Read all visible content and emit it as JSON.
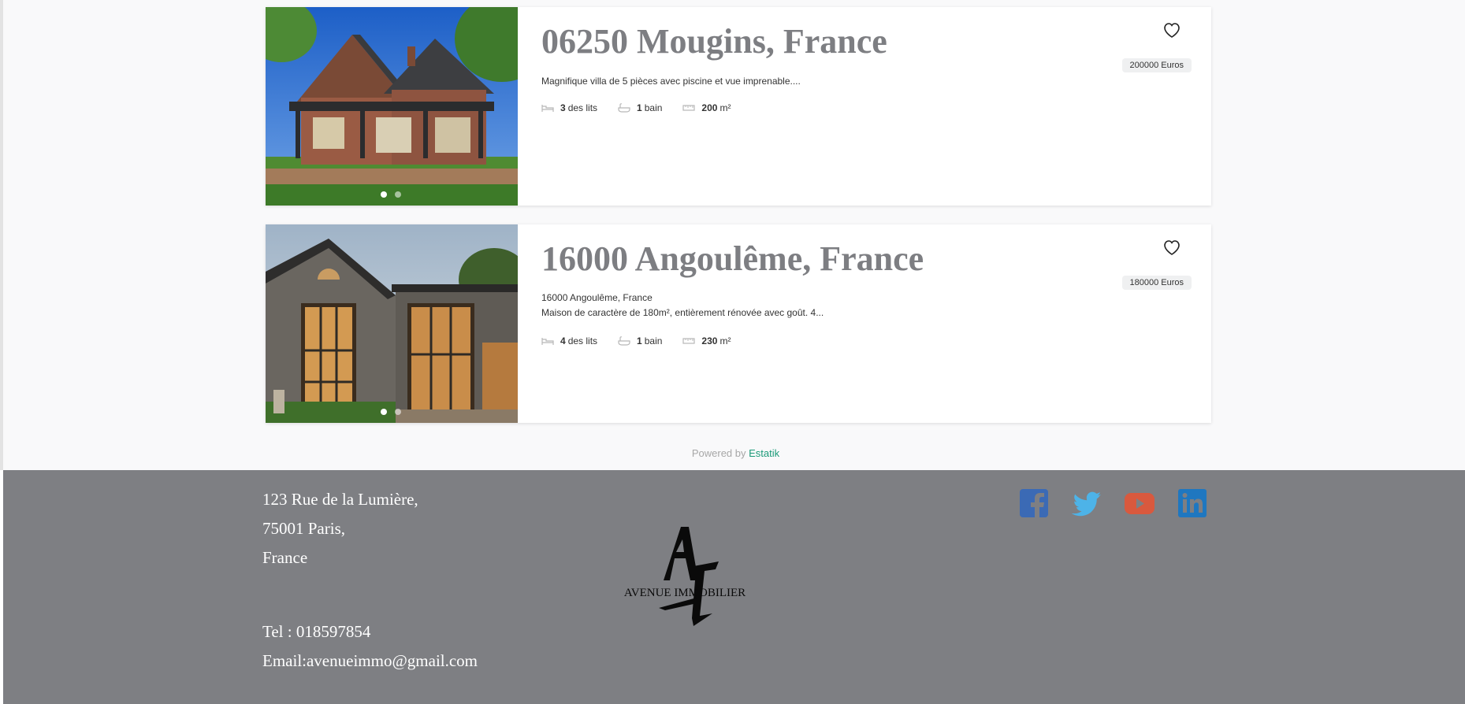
{
  "listings": [
    {
      "title": "06250 Mougins, France",
      "description_lines": [
        "Magnifique villa de 5 pièces avec piscine et vue imprenable...."
      ],
      "beds_value": "3",
      "beds_unit": "des lits",
      "baths_value": "1",
      "baths_unit": "bain",
      "area_value": "200",
      "area_unit": "m²",
      "price": "200000 Euros",
      "image_dots": 2,
      "active_dot": 0
    },
    {
      "title": "16000 Angoulême, France",
      "description_lines": [
        "16000 Angoulême, France",
        "Maison de caractère de 180m², entièrement rénovée avec goût. 4..."
      ],
      "beds_value": "4",
      "beds_unit": "des lits",
      "baths_value": "1",
      "baths_unit": "bain",
      "area_value": "230",
      "area_unit": "m²",
      "price": "180000 Euros",
      "image_dots": 2,
      "active_dot": 0
    }
  ],
  "powered": {
    "prefix": "Powered by",
    "link": "Estatik"
  },
  "footer": {
    "address_line1": "123 Rue de la Lumière,",
    "address_line2": "75001 Paris,",
    "address_line3": "France",
    "phone": "Tel : 018597854",
    "email": "Email:avenueimmo@gmail.com",
    "logo_text": "AVENUE IMMOBILIER",
    "logo_letters": "A I",
    "social": [
      {
        "name": "facebook-icon",
        "color": "#3b6ab5"
      },
      {
        "name": "twitter-icon",
        "color": "#4db3e8"
      },
      {
        "name": "youtube-icon",
        "color": "#d9593e"
      },
      {
        "name": "linkedin-icon",
        "color": "#1f77c0"
      }
    ]
  },
  "colors": {
    "title": "#7d7e82",
    "footer_bg": "#7e7f83",
    "accent_link": "#1b9a78"
  }
}
